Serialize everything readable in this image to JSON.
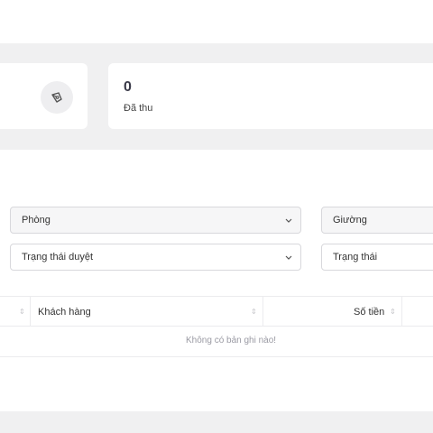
{
  "stats": {
    "collected_value": "0",
    "collected_label": "Đã thu",
    "collected_icon": "pen-nib-icon"
  },
  "filters": {
    "room_placeholder": "Phòng",
    "bed_placeholder": "Giường",
    "approval_status_placeholder": "Trạng thái duyệt",
    "status_placeholder": "Trạng thái"
  },
  "table": {
    "columns": [
      "Khách hàng",
      "Số tiền"
    ],
    "empty_message": "Không có bản ghi nào!"
  },
  "colors": {
    "page_bg": "#f0f0f1",
    "card_bg": "#ffffff",
    "border": "#d8d8dc",
    "muted_text": "#9a9aa3"
  }
}
